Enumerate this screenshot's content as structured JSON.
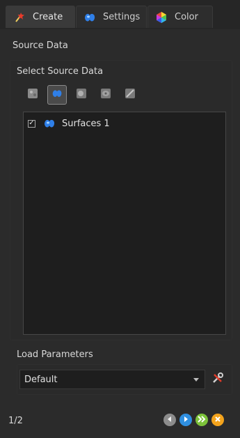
{
  "tabs": [
    {
      "label": "Create",
      "icon": "wand-icon",
      "active": true
    },
    {
      "label": "Settings",
      "icon": "surface-icon",
      "active": false
    },
    {
      "label": "Color",
      "icon": "color-wheel-icon",
      "active": false
    }
  ],
  "section_title": "Source Data",
  "source_group": {
    "label": "Select Source Data",
    "toolbar": [
      {
        "icon": "volume-icon",
        "selected": false
      },
      {
        "icon": "surface-icon",
        "selected": true
      },
      {
        "icon": "spots-icon",
        "selected": false
      },
      {
        "icon": "cells-icon",
        "selected": false
      },
      {
        "icon": "filaments-icon",
        "selected": false
      }
    ],
    "items": [
      {
        "label": "Surfaces 1",
        "checked": true,
        "icon": "surface-icon"
      }
    ]
  },
  "load_parameters": {
    "title": "Load Parameters",
    "selected": "Default",
    "tool_icon": "wrench-icon"
  },
  "footer": {
    "page": "1/2",
    "buttons": [
      {
        "icon": "back-icon"
      },
      {
        "icon": "next-icon"
      },
      {
        "icon": "finish-icon"
      },
      {
        "icon": "cancel-icon"
      }
    ]
  }
}
